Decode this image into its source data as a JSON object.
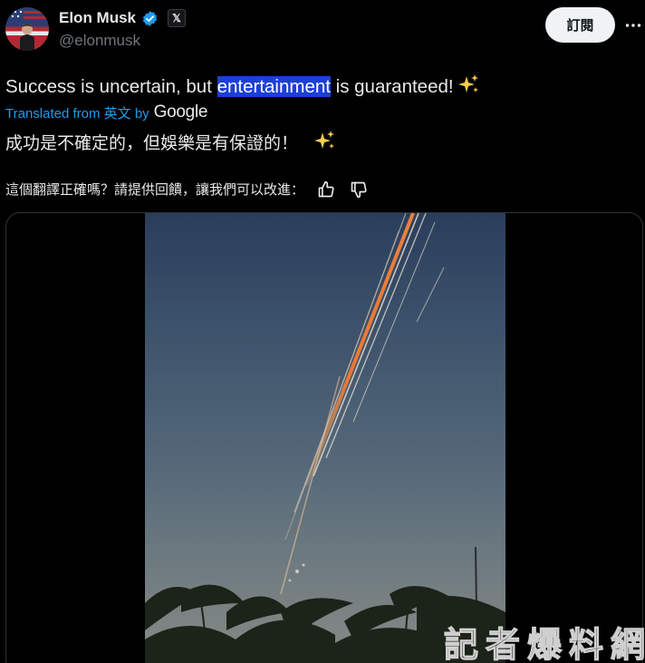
{
  "author": {
    "display_name": "Elon Musk",
    "handle": "@elonmusk",
    "affiliation_badge": "𝕏",
    "verified_color": "#1d9bf0"
  },
  "actions": {
    "subscribe_label": "訂閱",
    "more_icon": "more-horizontal-icon"
  },
  "tweet": {
    "text_before": "Success is uncertain, but ",
    "text_highlight": "entertainment",
    "text_after": " is guaranteed! ",
    "emoji": "sparkles-emoji",
    "highlight_color": "#1d3fd8"
  },
  "translation": {
    "label": "Translated from 英文 by",
    "provider": "Google",
    "text": "成功是不確定的，但娛樂是有保證的！",
    "link_color": "#1d9bf0"
  },
  "feedback": {
    "prompt": "這個翻譯正確嗎？請提供回饋，讓我們可以改進：",
    "like_icon": "thumbs-up-icon",
    "dislike_icon": "thumbs-down-icon"
  },
  "media": {
    "type": "video",
    "watermark": "記者爆料網"
  }
}
